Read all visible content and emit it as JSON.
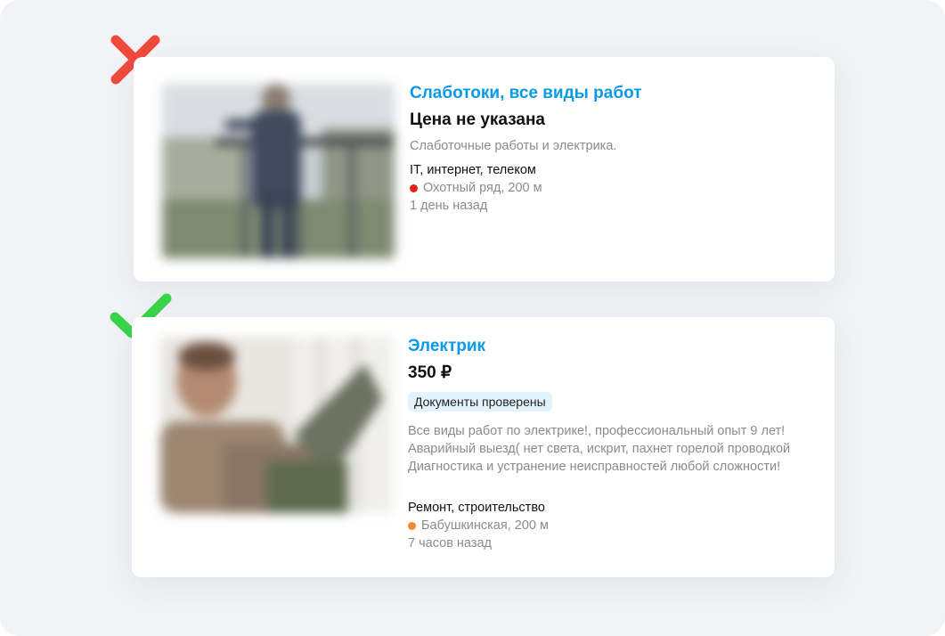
{
  "listings": [
    {
      "title": "Слаботоки, все виды работ",
      "price": "Цена не указана",
      "description": "Слаботочные работы и электрика.",
      "category": "IT, интернет, телеком",
      "metro": "Охотный ряд, 200 м",
      "metro_color": "#e42313",
      "time": "1 день назад",
      "verdict_icon": "x-mark-icon",
      "verdict_color": "#f04a3c"
    },
    {
      "title": "Электрик",
      "price": "350 ₽",
      "badge": "Документы проверены",
      "description": "Все виды работ по электрике!, профессиональный опыт 9 лет!\nАварийный выезд( нет света, искрит, пахнет горелой проводкой\nДиагностика и устранение неисправностей любой сложности!",
      "category": "Ремонт, строительство",
      "metro": "Бабушкинская, 200 м",
      "metro_color": "#f28a2e",
      "time": "7 часов назад",
      "verdict_icon": "check-mark-icon",
      "verdict_color": "#39d44a"
    }
  ],
  "colors": {
    "background": "#f2f3f6",
    "title_link": "#0a9ae8",
    "badge_bg": "#e3f3fd"
  }
}
